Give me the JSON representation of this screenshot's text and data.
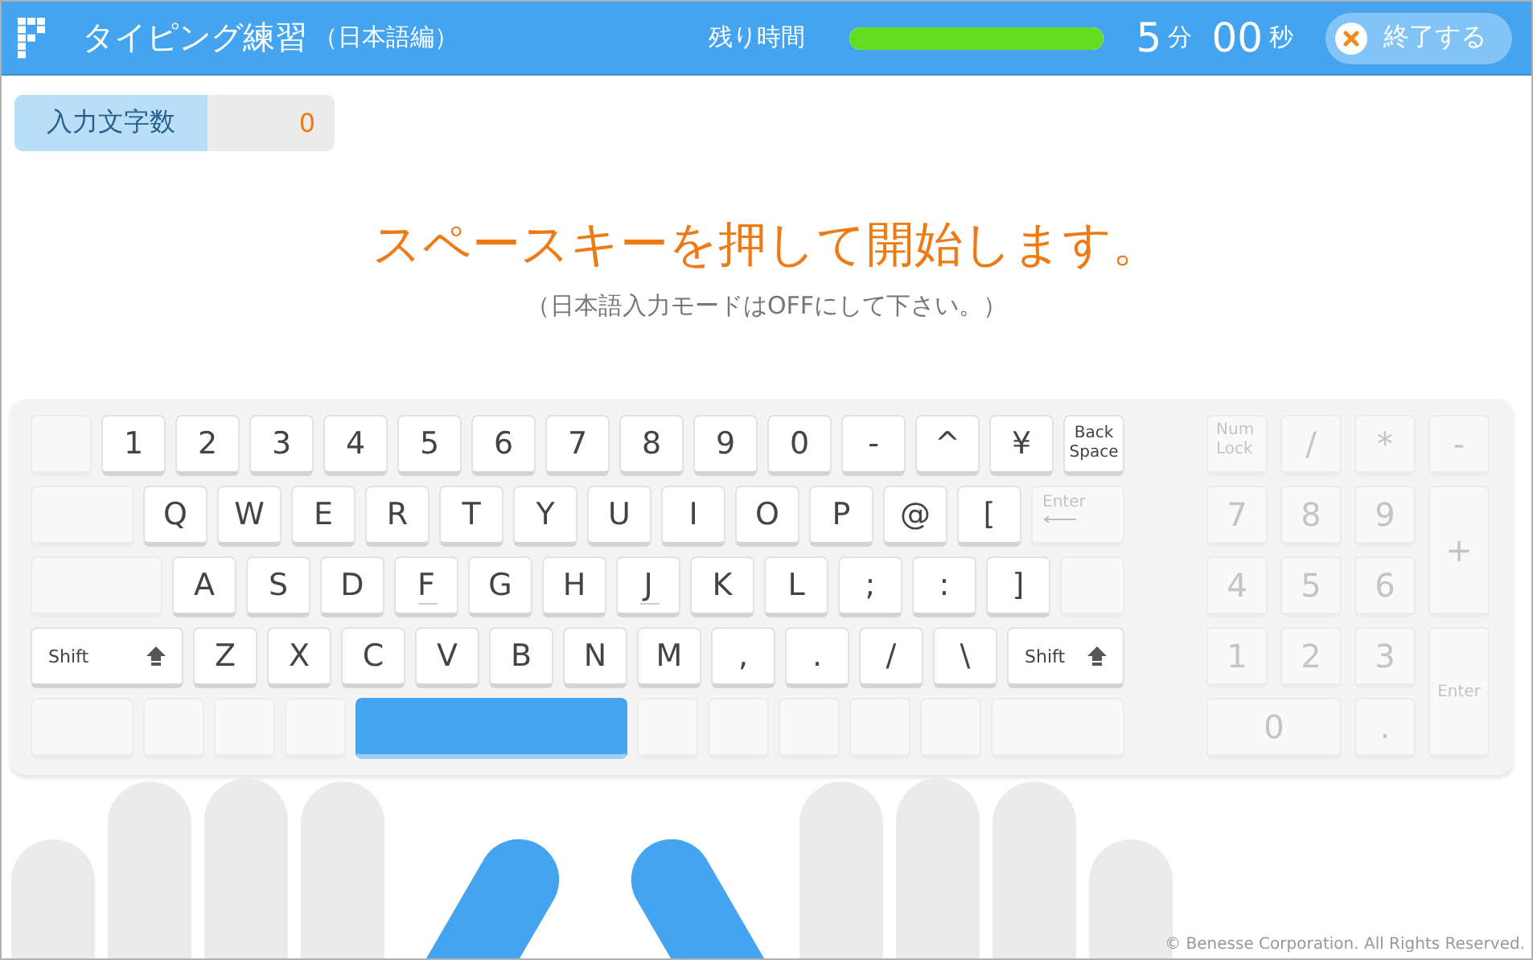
{
  "header": {
    "title": "タイピング練習",
    "subtitle": "（日本語編）",
    "time_label": "残り時間",
    "time_bar": {
      "level": 1
    },
    "minutes": "5",
    "minutes_unit": "分",
    "seconds": "00",
    "seconds_unit": "秒",
    "end_button": "終了する"
  },
  "counter": {
    "label": "入力文字数",
    "value": "0"
  },
  "message": {
    "main": "スペースキーを押して開始します。",
    "note": "（日本語入力モードはOFFにして下さい。）"
  },
  "keyboard": {
    "rows": [
      [
        {
          "kind": "blank",
          "highlighted": false
        },
        {
          "kind": "char",
          "label": "1",
          "disabled": false,
          "highlighted": false,
          "home": false
        },
        {
          "kind": "char",
          "label": "2",
          "disabled": false,
          "highlighted": false,
          "home": false
        },
        {
          "kind": "char",
          "label": "3",
          "disabled": false,
          "highlighted": false,
          "home": false
        },
        {
          "kind": "char",
          "label": "4",
          "disabled": false,
          "highlighted": false,
          "home": false
        },
        {
          "kind": "char",
          "label": "5",
          "disabled": false,
          "highlighted": false,
          "home": false
        },
        {
          "kind": "char",
          "label": "6",
          "disabled": false,
          "highlighted": false,
          "home": false
        },
        {
          "kind": "char",
          "label": "7",
          "disabled": false,
          "highlighted": false,
          "home": false
        },
        {
          "kind": "char",
          "label": "8",
          "disabled": false,
          "highlighted": false,
          "home": false
        },
        {
          "kind": "char",
          "label": "9",
          "disabled": false,
          "highlighted": false,
          "home": false
        },
        {
          "kind": "char",
          "label": "0",
          "disabled": false,
          "highlighted": false,
          "home": false
        },
        {
          "kind": "char",
          "label": "-",
          "disabled": false,
          "highlighted": false,
          "home": false
        },
        {
          "kind": "char",
          "label": "^",
          "disabled": false,
          "highlighted": false,
          "home": false
        },
        {
          "kind": "char",
          "label": "¥",
          "disabled": false,
          "highlighted": false,
          "home": false
        },
        {
          "kind": "small",
          "label": "Back Space",
          "disabled": false,
          "highlighted": false,
          "home": false
        }
      ],
      [
        {
          "kind": "blank",
          "highlighted": false
        },
        {
          "kind": "char",
          "label": "Q",
          "disabled": false,
          "highlighted": false,
          "home": false
        },
        {
          "kind": "char",
          "label": "W",
          "disabled": false,
          "highlighted": false,
          "home": false
        },
        {
          "kind": "char",
          "label": "E",
          "disabled": false,
          "highlighted": false,
          "home": false
        },
        {
          "kind": "char",
          "label": "R",
          "disabled": false,
          "highlighted": false,
          "home": false
        },
        {
          "kind": "char",
          "label": "T",
          "disabled": false,
          "highlighted": false,
          "home": false
        },
        {
          "kind": "char",
          "label": "Y",
          "disabled": false,
          "highlighted": false,
          "home": false
        },
        {
          "kind": "char",
          "label": "U",
          "disabled": false,
          "highlighted": false,
          "home": false
        },
        {
          "kind": "char",
          "label": "I",
          "disabled": false,
          "highlighted": false,
          "home": false
        },
        {
          "kind": "char",
          "label": "O",
          "disabled": false,
          "highlighted": false,
          "home": false
        },
        {
          "kind": "char",
          "label": "P",
          "disabled": false,
          "highlighted": false,
          "home": false
        },
        {
          "kind": "char",
          "label": "@",
          "disabled": false,
          "highlighted": false,
          "home": false
        },
        {
          "kind": "char",
          "label": "[",
          "disabled": false,
          "highlighted": false,
          "home": false
        },
        {
          "kind": "enter",
          "label": "Enter",
          "disabled": true,
          "highlighted": false,
          "home": false
        }
      ],
      [
        {
          "kind": "blank",
          "highlighted": false
        },
        {
          "kind": "char",
          "label": "A",
          "disabled": false,
          "highlighted": false,
          "home": false
        },
        {
          "kind": "char",
          "label": "S",
          "disabled": false,
          "highlighted": false,
          "home": false
        },
        {
          "kind": "char",
          "label": "D",
          "disabled": false,
          "highlighted": false,
          "home": false
        },
        {
          "kind": "char",
          "label": "F",
          "disabled": false,
          "highlighted": false,
          "home": true
        },
        {
          "kind": "char",
          "label": "G",
          "disabled": false,
          "highlighted": false,
          "home": false
        },
        {
          "kind": "char",
          "label": "H",
          "disabled": false,
          "highlighted": false,
          "home": false
        },
        {
          "kind": "char",
          "label": "J",
          "disabled": false,
          "highlighted": false,
          "home": true
        },
        {
          "kind": "char",
          "label": "K",
          "disabled": false,
          "highlighted": false,
          "home": false
        },
        {
          "kind": "char",
          "label": "L",
          "disabled": false,
          "highlighted": false,
          "home": false
        },
        {
          "kind": "char",
          "label": ";",
          "disabled": false,
          "highlighted": false,
          "home": false
        },
        {
          "kind": "char",
          "label": ":",
          "disabled": false,
          "highlighted": false,
          "home": false
        },
        {
          "kind": "char",
          "label": "]",
          "disabled": false,
          "highlighted": false,
          "home": false
        },
        {
          "kind": "blank",
          "highlighted": false
        }
      ],
      [
        {
          "kind": "shift",
          "label": "Shift",
          "disabled": false,
          "highlighted": false,
          "home": false
        },
        {
          "kind": "char",
          "label": "Z",
          "disabled": false,
          "highlighted": false,
          "home": false
        },
        {
          "kind": "char",
          "label": "X",
          "disabled": false,
          "highlighted": false,
          "home": false
        },
        {
          "kind": "char",
          "label": "C",
          "disabled": false,
          "highlighted": false,
          "home": false
        },
        {
          "kind": "char",
          "label": "V",
          "disabled": false,
          "highlighted": false,
          "home": false
        },
        {
          "kind": "char",
          "label": "B",
          "disabled": false,
          "highlighted": false,
          "home": false
        },
        {
          "kind": "char",
          "label": "N",
          "disabled": false,
          "highlighted": false,
          "home": false
        },
        {
          "kind": "char",
          "label": "M",
          "disabled": false,
          "highlighted": false,
          "home": false
        },
        {
          "kind": "char",
          "label": ",",
          "disabled": false,
          "highlighted": false,
          "home": false
        },
        {
          "kind": "char",
          "label": ".",
          "disabled": false,
          "highlighted": false,
          "home": false
        },
        {
          "kind": "char",
          "label": "/",
          "disabled": false,
          "highlighted": false,
          "home": false
        },
        {
          "kind": "char",
          "label": "\\",
          "disabled": false,
          "highlighted": false,
          "home": false
        },
        {
          "kind": "shift",
          "label": "Shift",
          "disabled": false,
          "highlighted": false,
          "home": false
        }
      ],
      [
        {
          "kind": "blank",
          "highlighted": false
        },
        {
          "kind": "blank",
          "highlighted": false
        },
        {
          "kind": "blank",
          "highlighted": false
        },
        {
          "kind": "blank",
          "highlighted": false
        },
        {
          "kind": "space",
          "highlighted": true
        },
        {
          "kind": "blank",
          "highlighted": false
        },
        {
          "kind": "blank",
          "highlighted": false
        },
        {
          "kind": "blank",
          "highlighted": false
        },
        {
          "kind": "blank",
          "highlighted": false
        },
        {
          "kind": "blank",
          "highlighted": false
        },
        {
          "kind": "blank",
          "highlighted": false
        }
      ]
    ],
    "numpad": [
      {
        "kind": "small",
        "label": "Num Lock",
        "disabled": true
      },
      {
        "kind": "char",
        "label": "/",
        "disabled": true
      },
      {
        "kind": "char",
        "label": "*",
        "disabled": true
      },
      {
        "kind": "char",
        "label": "-",
        "disabled": true
      },
      {
        "kind": "char",
        "label": "7",
        "disabled": true
      },
      {
        "kind": "char",
        "label": "8",
        "disabled": true
      },
      {
        "kind": "char",
        "label": "9",
        "disabled": true
      },
      {
        "kind": "tall",
        "label": "+",
        "disabled": true
      },
      {
        "kind": "char",
        "label": "4",
        "disabled": true
      },
      {
        "kind": "char",
        "label": "5",
        "disabled": true
      },
      {
        "kind": "char",
        "label": "6",
        "disabled": true
      },
      {
        "kind": "char",
        "label": "1",
        "disabled": true
      },
      {
        "kind": "char",
        "label": "2",
        "disabled": true
      },
      {
        "kind": "char",
        "label": "3",
        "disabled": true
      },
      {
        "kind": "tall-small",
        "label": "Enter",
        "disabled": true
      },
      {
        "kind": "wide",
        "label": "0",
        "disabled": true
      },
      {
        "kind": "char",
        "label": ".",
        "disabled": true
      }
    ]
  },
  "footer": {
    "copyright": "© Benesse Corporation. All Rights Reserved."
  }
}
